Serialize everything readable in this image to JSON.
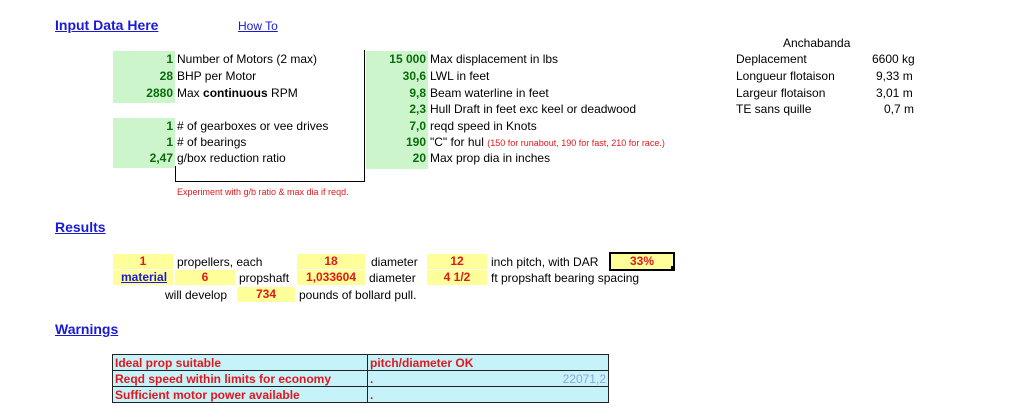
{
  "headers": {
    "input": "Input Data Here",
    "howto": "How To",
    "results": "Results",
    "warnings": "Warnings"
  },
  "motors": [
    {
      "value": "1",
      "label": "Number of Motors (2 max)"
    },
    {
      "value": "28",
      "label": "BHP per Motor"
    },
    {
      "value": "2880",
      "label_pre": "Max ",
      "label_bold": "continuous",
      "label_post": " RPM"
    }
  ],
  "gear": [
    {
      "value": "1",
      "label": "# of gearboxes or vee drives"
    },
    {
      "value": "1",
      "label": "# of bearings"
    },
    {
      "value": "2,47",
      "label": "g/box reduction ratio"
    }
  ],
  "hull": [
    {
      "value": "15 000",
      "label": "Max displacement in lbs"
    },
    {
      "value": "30,6",
      "label": "LWL in feet"
    },
    {
      "value": "9,8",
      "label": "Beam waterline in feet"
    },
    {
      "value": "2,3",
      "label": "Hull Draft in feet exc keel or deadwood"
    },
    {
      "value": "7,0",
      "label": "reqd speed in Knots"
    },
    {
      "value": "190",
      "label": "\"C\" for hul",
      "note": "(150 for runabout, 190 for fast, 210 for race.)"
    },
    {
      "value": "20",
      "label": "Max prop dia in inches"
    }
  ],
  "experiment_note": "Experiment with g/b ratio & max dia if reqd.",
  "boat": {
    "title": "Anchabanda",
    "rows": [
      {
        "label": "Deplacement",
        "value": "6600 kg"
      },
      {
        "label": "Longueur flotaison",
        "value": "9,33 m"
      },
      {
        "label": "Largeur flotaison",
        "value": "3,01 m"
      },
      {
        "label": "TE sans quille",
        "value": "0,7 m"
      }
    ]
  },
  "results": {
    "props": "1",
    "props_label": "propellers, each",
    "diameter": "18",
    "diameter_label": "diameter",
    "pitch": "12",
    "pitch_label": "inch pitch, with DAR",
    "dar": "33%",
    "material_link": "material",
    "shaft": "6",
    "shaft_label": "propshaft",
    "shaft_dia": "1,033604",
    "shaft_dia_label": "diameter",
    "spacing": "4 1/2",
    "spacing_label": "ft propshaft bearing spacing",
    "develop_label": "will develop",
    "pull": "734",
    "pull_label": "pounds of bollard pull."
  },
  "warnings": [
    {
      "a": "Ideal prop suitable",
      "b": "pitch/diameter OK",
      "c": ""
    },
    {
      "a": "Reqd speed within limits for economy",
      "b": ".",
      "c": "22071,2"
    },
    {
      "a": "Sufficient motor power available",
      "b": ".",
      "c": ""
    }
  ]
}
